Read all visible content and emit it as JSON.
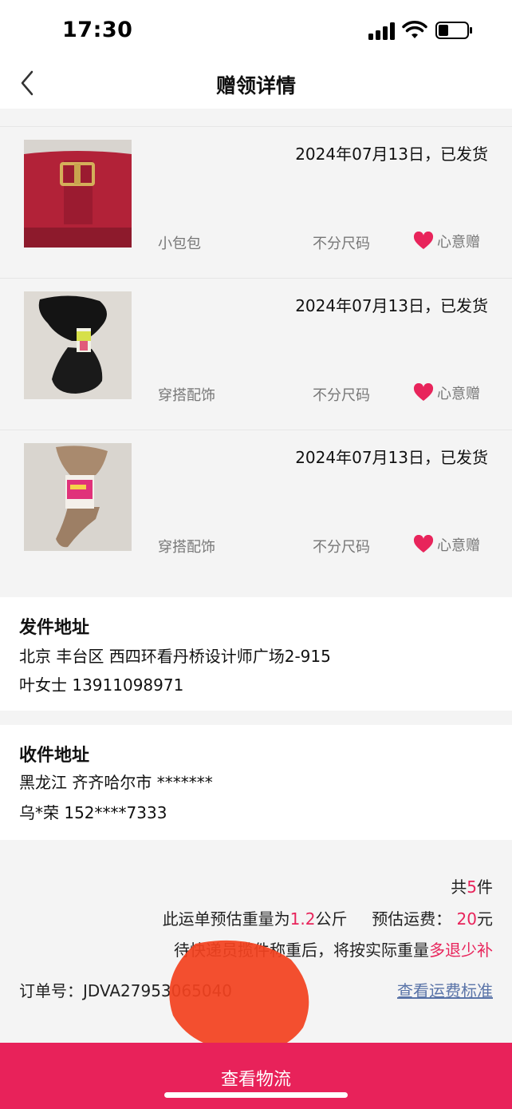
{
  "status_bar": {
    "time": "17:30"
  },
  "header": {
    "title": "赠领详情",
    "back_icon": "chevron-left-icon"
  },
  "items": [
    {
      "date": "2024年07月13日，已发货",
      "category": "小包包",
      "size": "不分尺码",
      "gift_label": "心意赠",
      "image": "red-handbag"
    },
    {
      "date": "2024年07月13日，已发货",
      "category": "穿搭配饰",
      "size": "不分尺码",
      "gift_label": "心意赠",
      "image": "black-stockings"
    },
    {
      "date": "2024年07月13日，已发货",
      "category": "穿搭配饰",
      "size": "不分尺码",
      "gift_label": "心意赠",
      "image": "nude-stockings"
    }
  ],
  "sender": {
    "title": "发件地址",
    "address": "北京 丰台区 西四环看丹桥设计师广场2-915",
    "contact": "叶女士 13911098971"
  },
  "receiver": {
    "title": "收件地址",
    "address": "黑龙江 齐齐哈尔市 *******",
    "contact": "乌*荣 152****7333"
  },
  "summary": {
    "count_prefix": "共",
    "count": "5",
    "count_suffix": "件",
    "weight_prefix": "此运单预估重量为",
    "weight": "1.2",
    "weight_unit": "公斤",
    "fee_label": "预估运费：",
    "fee": "20",
    "fee_unit": "元",
    "note_prefix": "待快递员揽件称重后，将按实际重量",
    "note_highlight": "多退少补"
  },
  "order": {
    "label": "订单号：",
    "number": "JDVA27953065040"
  },
  "fee_link": "查看运费标准",
  "bottom_button": "查看物流",
  "colors": {
    "accent": "#e8225a",
    "link": "#5a74a8",
    "heart": "#e8245b"
  }
}
